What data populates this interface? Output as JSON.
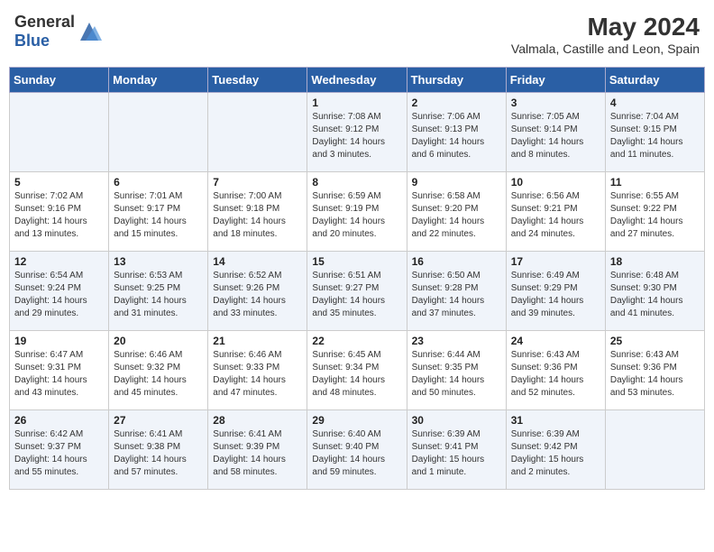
{
  "header": {
    "logo_general": "General",
    "logo_blue": "Blue",
    "title": "May 2024",
    "subtitle": "Valmala, Castille and Leon, Spain"
  },
  "days_of_week": [
    "Sunday",
    "Monday",
    "Tuesday",
    "Wednesday",
    "Thursday",
    "Friday",
    "Saturday"
  ],
  "weeks": [
    [
      {
        "day": "",
        "info": ""
      },
      {
        "day": "",
        "info": ""
      },
      {
        "day": "",
        "info": ""
      },
      {
        "day": "1",
        "info": "Sunrise: 7:08 AM\nSunset: 9:12 PM\nDaylight: 14 hours\nand 3 minutes."
      },
      {
        "day": "2",
        "info": "Sunrise: 7:06 AM\nSunset: 9:13 PM\nDaylight: 14 hours\nand 6 minutes."
      },
      {
        "day": "3",
        "info": "Sunrise: 7:05 AM\nSunset: 9:14 PM\nDaylight: 14 hours\nand 8 minutes."
      },
      {
        "day": "4",
        "info": "Sunrise: 7:04 AM\nSunset: 9:15 PM\nDaylight: 14 hours\nand 11 minutes."
      }
    ],
    [
      {
        "day": "5",
        "info": "Sunrise: 7:02 AM\nSunset: 9:16 PM\nDaylight: 14 hours\nand 13 minutes."
      },
      {
        "day": "6",
        "info": "Sunrise: 7:01 AM\nSunset: 9:17 PM\nDaylight: 14 hours\nand 15 minutes."
      },
      {
        "day": "7",
        "info": "Sunrise: 7:00 AM\nSunset: 9:18 PM\nDaylight: 14 hours\nand 18 minutes."
      },
      {
        "day": "8",
        "info": "Sunrise: 6:59 AM\nSunset: 9:19 PM\nDaylight: 14 hours\nand 20 minutes."
      },
      {
        "day": "9",
        "info": "Sunrise: 6:58 AM\nSunset: 9:20 PM\nDaylight: 14 hours\nand 22 minutes."
      },
      {
        "day": "10",
        "info": "Sunrise: 6:56 AM\nSunset: 9:21 PM\nDaylight: 14 hours\nand 24 minutes."
      },
      {
        "day": "11",
        "info": "Sunrise: 6:55 AM\nSunset: 9:22 PM\nDaylight: 14 hours\nand 27 minutes."
      }
    ],
    [
      {
        "day": "12",
        "info": "Sunrise: 6:54 AM\nSunset: 9:24 PM\nDaylight: 14 hours\nand 29 minutes."
      },
      {
        "day": "13",
        "info": "Sunrise: 6:53 AM\nSunset: 9:25 PM\nDaylight: 14 hours\nand 31 minutes."
      },
      {
        "day": "14",
        "info": "Sunrise: 6:52 AM\nSunset: 9:26 PM\nDaylight: 14 hours\nand 33 minutes."
      },
      {
        "day": "15",
        "info": "Sunrise: 6:51 AM\nSunset: 9:27 PM\nDaylight: 14 hours\nand 35 minutes."
      },
      {
        "day": "16",
        "info": "Sunrise: 6:50 AM\nSunset: 9:28 PM\nDaylight: 14 hours\nand 37 minutes."
      },
      {
        "day": "17",
        "info": "Sunrise: 6:49 AM\nSunset: 9:29 PM\nDaylight: 14 hours\nand 39 minutes."
      },
      {
        "day": "18",
        "info": "Sunrise: 6:48 AM\nSunset: 9:30 PM\nDaylight: 14 hours\nand 41 minutes."
      }
    ],
    [
      {
        "day": "19",
        "info": "Sunrise: 6:47 AM\nSunset: 9:31 PM\nDaylight: 14 hours\nand 43 minutes."
      },
      {
        "day": "20",
        "info": "Sunrise: 6:46 AM\nSunset: 9:32 PM\nDaylight: 14 hours\nand 45 minutes."
      },
      {
        "day": "21",
        "info": "Sunrise: 6:46 AM\nSunset: 9:33 PM\nDaylight: 14 hours\nand 47 minutes."
      },
      {
        "day": "22",
        "info": "Sunrise: 6:45 AM\nSunset: 9:34 PM\nDaylight: 14 hours\nand 48 minutes."
      },
      {
        "day": "23",
        "info": "Sunrise: 6:44 AM\nSunset: 9:35 PM\nDaylight: 14 hours\nand 50 minutes."
      },
      {
        "day": "24",
        "info": "Sunrise: 6:43 AM\nSunset: 9:36 PM\nDaylight: 14 hours\nand 52 minutes."
      },
      {
        "day": "25",
        "info": "Sunrise: 6:43 AM\nSunset: 9:36 PM\nDaylight: 14 hours\nand 53 minutes."
      }
    ],
    [
      {
        "day": "26",
        "info": "Sunrise: 6:42 AM\nSunset: 9:37 PM\nDaylight: 14 hours\nand 55 minutes."
      },
      {
        "day": "27",
        "info": "Sunrise: 6:41 AM\nSunset: 9:38 PM\nDaylight: 14 hours\nand 57 minutes."
      },
      {
        "day": "28",
        "info": "Sunrise: 6:41 AM\nSunset: 9:39 PM\nDaylight: 14 hours\nand 58 minutes."
      },
      {
        "day": "29",
        "info": "Sunrise: 6:40 AM\nSunset: 9:40 PM\nDaylight: 14 hours\nand 59 minutes."
      },
      {
        "day": "30",
        "info": "Sunrise: 6:39 AM\nSunset: 9:41 PM\nDaylight: 15 hours\nand 1 minute."
      },
      {
        "day": "31",
        "info": "Sunrise: 6:39 AM\nSunset: 9:42 PM\nDaylight: 15 hours\nand 2 minutes."
      },
      {
        "day": "",
        "info": ""
      }
    ]
  ]
}
